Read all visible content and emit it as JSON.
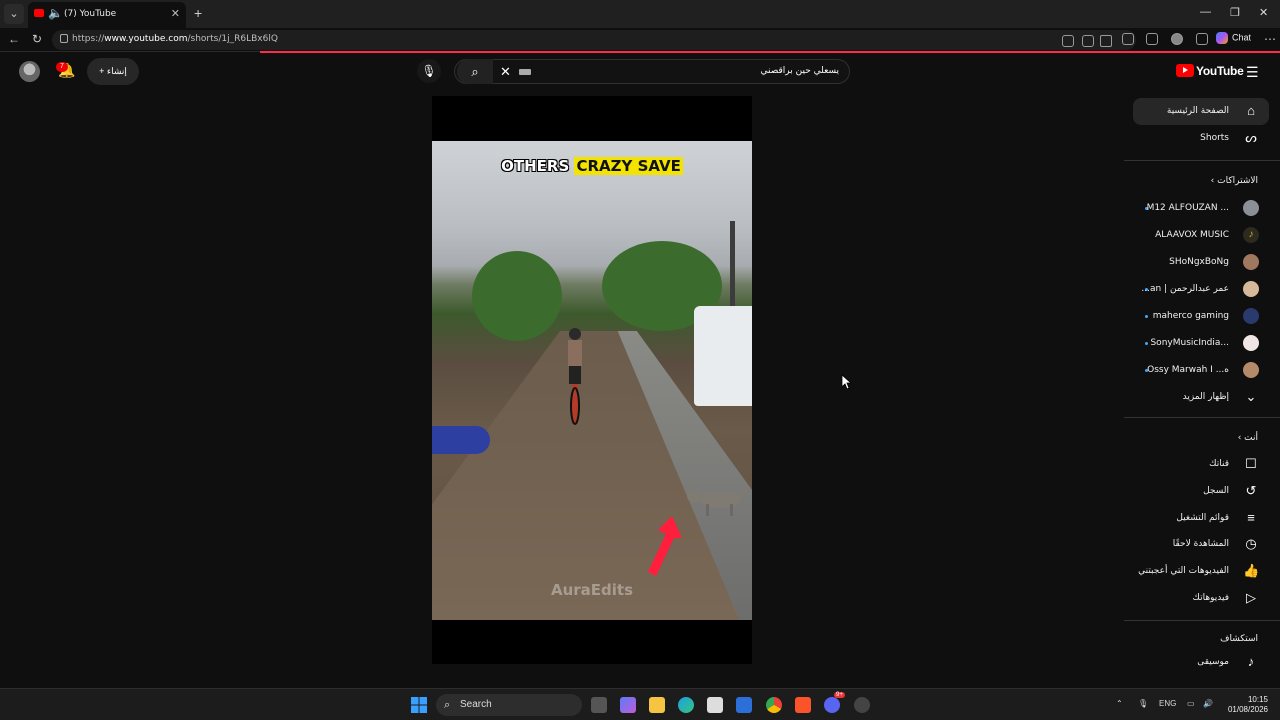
{
  "browser": {
    "tab_title": "(7) YouTube",
    "url_prefix": "https://",
    "url_host": "www.youtube.com",
    "url_path": "/shorts/1j_R6LBx6lQ",
    "chat_label": "Chat",
    "new_tab": "+",
    "close_tab": "✕"
  },
  "header": {
    "notifications_count": "7",
    "create_label": "إنشاء",
    "search_query": "يسعلي حين براقصني",
    "logo_text": "YouTube"
  },
  "video": {
    "caption_white": "OTHERS",
    "caption_highlight": "CRAZY SAVE",
    "watermark": "AuraEdits"
  },
  "sidebar": {
    "home": "الصفحة الرئيسية",
    "shorts": "Shorts",
    "subscriptions_header": "الاشتراكات",
    "subscriptions": [
      {
        "name": "M12 ALFOUZAN ...",
        "new": true
      },
      {
        "name": "ALAAVOX MUSIC",
        "new": false
      },
      {
        "name": "SHoNgxBoNg",
        "new": false
      },
      {
        "name": "عمر عبدالرحمن | an...",
        "new": true
      },
      {
        "name": "maherco gaming",
        "new": true
      },
      {
        "name": "SonyMusicIndia...",
        "new": true
      },
      {
        "name": "Ossy Marwah I ...ه",
        "new": true
      }
    ],
    "show_more": "إظهار المزيد",
    "you_header": "أنت",
    "you_items": [
      "قناتك",
      "السجل",
      "قوائم التشغيل",
      "المشاهدة لاحقًا",
      "الفيديوهات التي أعجبتني",
      "فيديوهاتك"
    ],
    "explore_header": "استكشاف",
    "explore_items": [
      "موسيقى"
    ]
  },
  "taskbar": {
    "search_label": "Search",
    "lang": "ENG",
    "time": "10:15",
    "date": "01/08/2026",
    "discord_badge": "9+"
  },
  "colors": {
    "brand_red": "#ff0000",
    "accent_blue": "#3ea6ff",
    "caption_yellow": "#f2e400"
  }
}
